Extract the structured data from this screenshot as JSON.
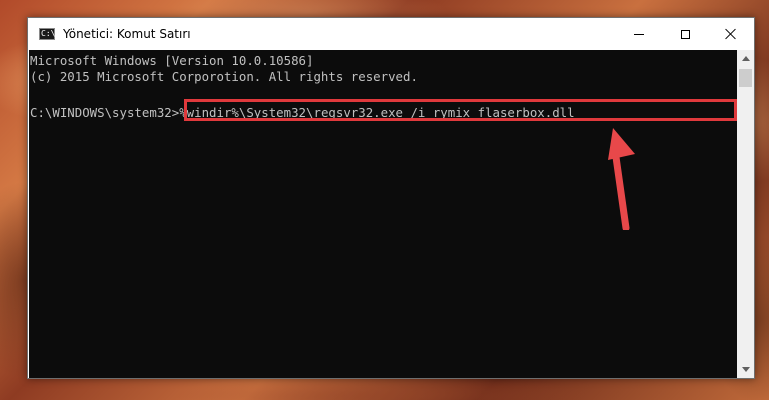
{
  "window": {
    "title": "Yönetici: Komut Satırı",
    "icon": "cmd-icon",
    "controls": {
      "minimize": "minimize-icon",
      "maximize": "maximize-icon",
      "close": "close-icon"
    }
  },
  "console": {
    "line1": "Microsoft Windows [Version 10.0.10586]",
    "line2": "(c) 2015 Microsoft Corporotion. All rights reserved.",
    "prompt": "C:\\WINDOWS\\system32>",
    "command": "%windir%\\System32\\regsvr32.exe /i rymix flaserbox.dll"
  },
  "annotation": {
    "highlight_color": "#e0393c",
    "arrow_color": "#e8484a"
  },
  "colors": {
    "console_bg": "#0c0c0c",
    "console_text": "#c0c0c0"
  }
}
